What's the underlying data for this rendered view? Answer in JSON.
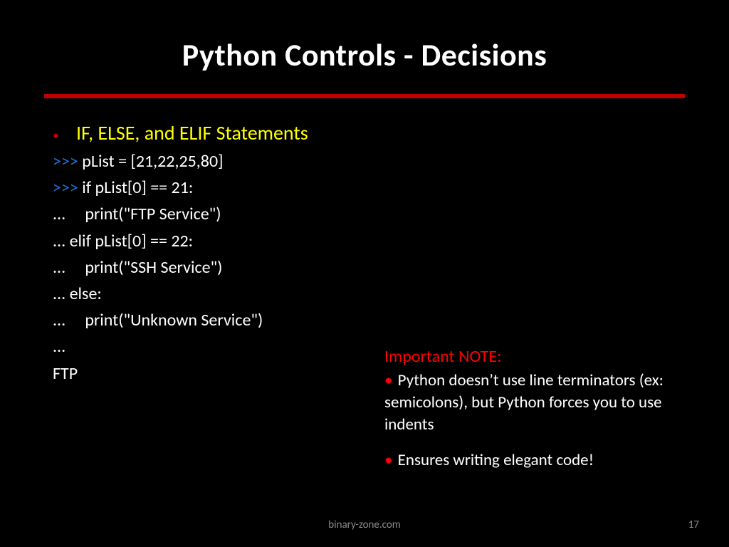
{
  "title": "Python Controls - Decisions",
  "heading": "IF, ELSE, and ELIF Statements",
  "code": {
    "p1": ">>> ",
    "l1": "pList = [21,22,25,80]",
    "p2": ">>> ",
    "l2": "if pList[0] == 21:",
    "p3": "...     ",
    "l3": "print(\"FTP Service\")",
    "p4": "... ",
    "l4": "elif pList[0] == 22:",
    "p5": "...     ",
    "l5": "print(\"SSH Service\")",
    "p6": "... ",
    "l6": "else:",
    "p7": "...     ",
    "l7": "print(\"Unknown Service\")",
    "p8": "...",
    "l8": "",
    "l9": "FTP"
  },
  "note": {
    "heading": "Important NOTE:",
    "item1a": "Python doesn",
    "apos": "’",
    "item1b": "t use line terminators (ex: semicolons), but Python forces you to use indents",
    "item2": "Ensures writing elegant code!"
  },
  "footer": {
    "center": "binary-zone.com",
    "page": "17"
  }
}
